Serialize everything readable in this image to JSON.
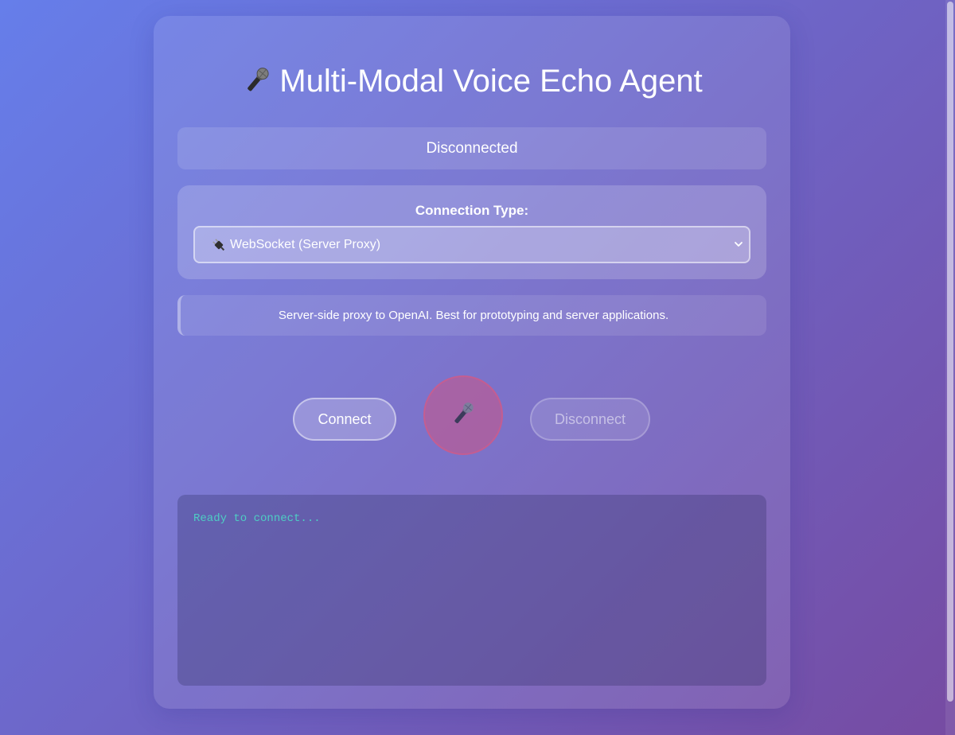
{
  "app": {
    "title": "Multi-Modal Voice Echo Agent",
    "title_icon": "microphone-icon"
  },
  "status": {
    "text": "Disconnected"
  },
  "connection": {
    "label": "Connection Type:",
    "selected_icon": "plug-icon",
    "selected_value": "WebSocket (Server Proxy)"
  },
  "description": {
    "text": "Server-side proxy to OpenAI. Best for prototyping and server applications."
  },
  "controls": {
    "connect_label": "Connect",
    "mic_icon": "microphone-icon",
    "disconnect_label": "Disconnect",
    "disconnect_enabled": false
  },
  "log": {
    "lines": [
      "Ready to connect..."
    ]
  },
  "colors": {
    "gradient_start": "#667eea",
    "gradient_end": "#764ba2",
    "log_text": "#4ecdc4",
    "mic_button": "#dc5078"
  }
}
